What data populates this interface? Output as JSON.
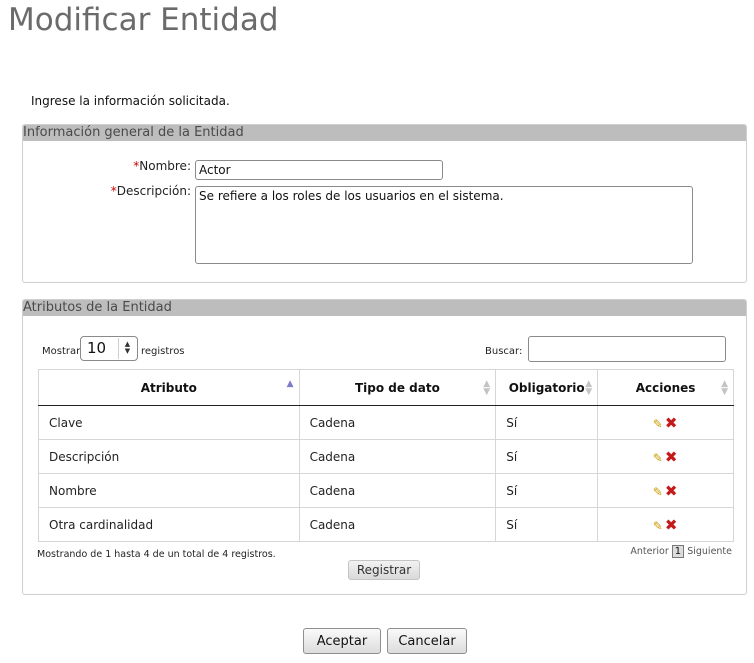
{
  "page": {
    "title": "Modificar Entidad",
    "instructions": "Ingrese la información solicitada."
  },
  "general_section": {
    "header": "Información general de la Entidad",
    "required_mark": "*",
    "name_label": "Nombre:",
    "name_value": "Actor",
    "description_label": "Descripción:",
    "description_value": "Se refiere a los roles de los usuarios en el sistema."
  },
  "attributes_section": {
    "header": "Atributos de la Entidad",
    "show_label": "Mostrar",
    "page_size": "10",
    "records_label": "registros",
    "search_label": "Buscar:",
    "search_value": "",
    "columns": [
      "Atributo",
      "Tipo de dato",
      "Obligatorio",
      "Acciones"
    ],
    "rows": [
      {
        "attribute": "Clave",
        "type": "Cadena",
        "required": "Sí"
      },
      {
        "attribute": "Descripción",
        "type": "Cadena",
        "required": "Sí"
      },
      {
        "attribute": "Nombre",
        "type": "Cadena",
        "required": "Sí"
      },
      {
        "attribute": "Otra cardinalidad",
        "type": "Cadena",
        "required": "Sí"
      }
    ],
    "row_icons": {
      "edit": "pencil-icon",
      "delete": "delete-x-icon"
    },
    "info": "Mostrando de 1 hasta 4 de un total de 4 registros.",
    "pager": {
      "previous": "Anterior",
      "current": "1",
      "next": "Siguiente"
    },
    "register_button": "Registrar"
  },
  "footer": {
    "accept_button": "Aceptar",
    "cancel_button": "Cancelar"
  },
  "colors": {
    "section_header_bg": "#bdbdbd",
    "title_color": "#6b6b6b",
    "required_color": "#cc0000",
    "delete_color": "#c41a1a",
    "edit_color": "#c89c00",
    "sort_active_color": "#7c7cc8"
  }
}
